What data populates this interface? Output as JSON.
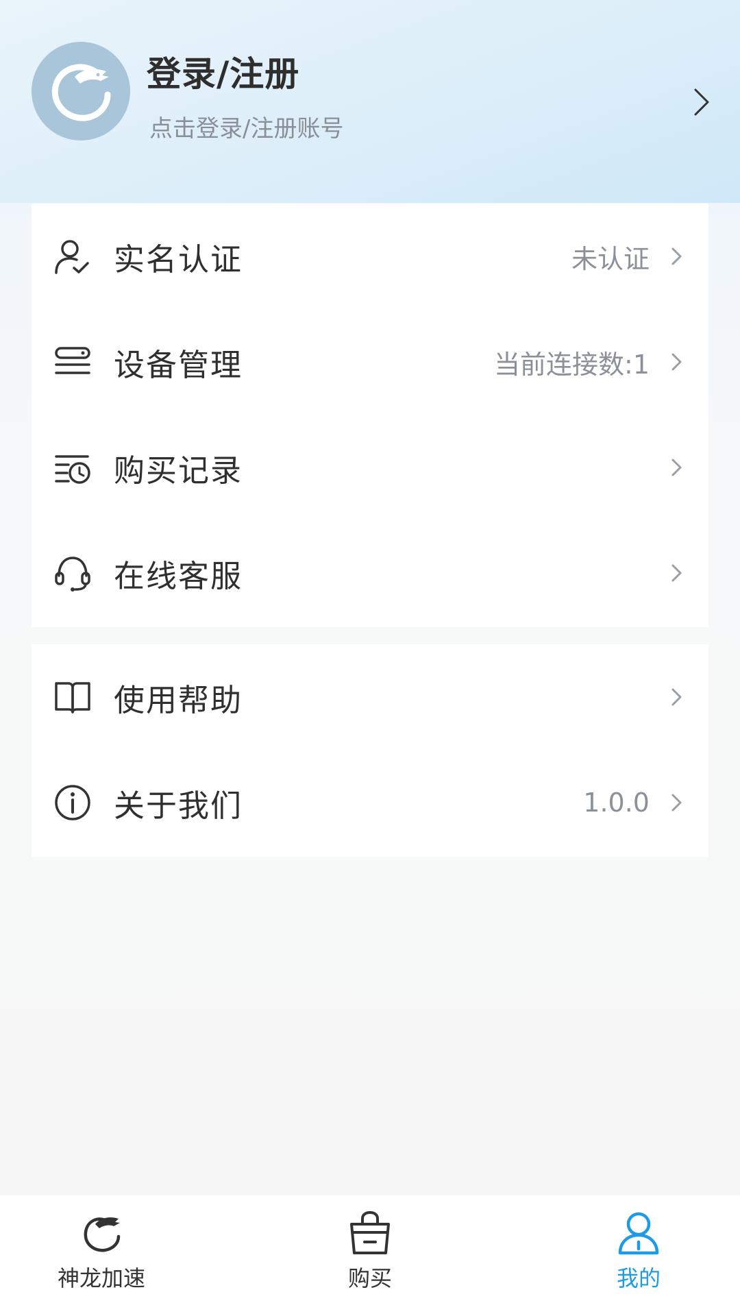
{
  "profile": {
    "title": "登录/注册",
    "subtitle": "点击登录/注册账号",
    "avatar_icon": "dragon-logo-icon",
    "chevron_icon": "chevron-right-icon"
  },
  "menu_group_1": [
    {
      "label": "实名认证",
      "value": "未认证",
      "icon": "user-check-icon"
    },
    {
      "label": "设备管理",
      "value": "当前连接数:1",
      "icon": "device-icon"
    },
    {
      "label": "购买记录",
      "value": "",
      "icon": "purchase-history-icon"
    },
    {
      "label": "在线客服",
      "value": "",
      "icon": "headset-icon"
    }
  ],
  "menu_group_2": [
    {
      "label": "使用帮助",
      "value": "",
      "icon": "book-icon"
    },
    {
      "label": "关于我们",
      "value": "1.0.0",
      "icon": "info-icon"
    }
  ],
  "tabbar": [
    {
      "label": "神龙加速",
      "icon": "dragon-icon",
      "active": false
    },
    {
      "label": "购买",
      "icon": "shopping-bag-icon",
      "active": false
    },
    {
      "label": "我的",
      "icon": "profile-icon",
      "active": true
    }
  ],
  "colors": {
    "accent": "#1e9be8",
    "avatar_bg": "#a8c5da",
    "secondary_text": "#8b9099"
  }
}
